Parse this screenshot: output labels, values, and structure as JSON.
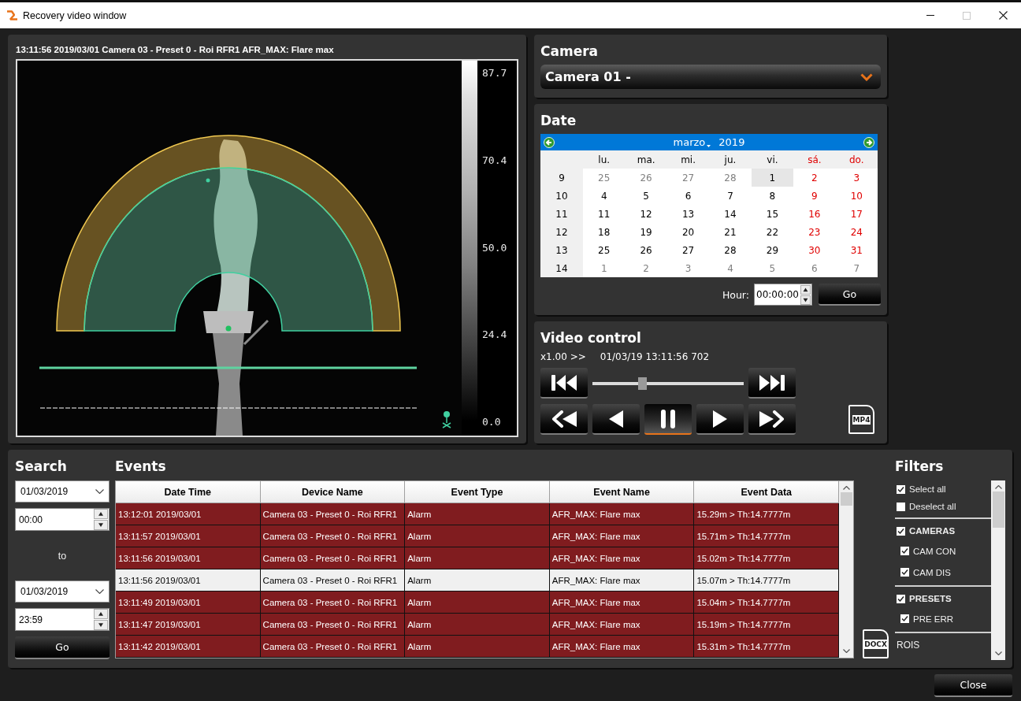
{
  "window": {
    "title": "Recovery video window",
    "controls": [
      {
        "kind": "minimize",
        "disabled": false
      },
      {
        "kind": "maximize",
        "disabled": true
      },
      {
        "kind": "close",
        "disabled": false
      }
    ]
  },
  "video": {
    "caption": "13:11:56 2019/03/01 Camera 03 - Preset 0 - Roi RFR1 AFR_MAX: Flare max",
    "scale_labels": [
      "87.7",
      "70.4",
      "50.0",
      "24.4",
      "0.0"
    ]
  },
  "camera": {
    "title": "Camera",
    "selected_camera": "Camera 01 -"
  },
  "date": {
    "title": "Date",
    "month": "marzo",
    "year": "2019",
    "weekdays": [
      {
        "label": "lu.",
        "kind": "weekday"
      },
      {
        "label": "ma.",
        "kind": "weekday"
      },
      {
        "label": "mi.",
        "kind": "weekday"
      },
      {
        "label": "ju.",
        "kind": "weekday"
      },
      {
        "label": "vi.",
        "kind": "weekday"
      },
      {
        "label": "sá.",
        "kind": "weekend"
      },
      {
        "label": "do.",
        "kind": "weekend"
      }
    ],
    "weeks": [
      {
        "number": "9",
        "days": [
          {
            "day": "25",
            "kind": "other",
            "selected": false
          },
          {
            "day": "26",
            "kind": "other",
            "selected": false
          },
          {
            "day": "27",
            "kind": "other",
            "selected": false
          },
          {
            "day": "28",
            "kind": "other",
            "selected": false
          },
          {
            "day": "1",
            "kind": "weekday",
            "selected": true
          },
          {
            "day": "2",
            "kind": "weekend",
            "selected": false
          },
          {
            "day": "3",
            "kind": "weekend",
            "selected": false
          }
        ]
      },
      {
        "number": "10",
        "days": [
          {
            "day": "4",
            "kind": "weekday",
            "selected": false
          },
          {
            "day": "5",
            "kind": "weekday",
            "selected": false
          },
          {
            "day": "6",
            "kind": "weekday",
            "selected": false
          },
          {
            "day": "7",
            "kind": "weekday",
            "selected": false
          },
          {
            "day": "8",
            "kind": "weekday",
            "selected": false
          },
          {
            "day": "9",
            "kind": "weekend",
            "selected": false
          },
          {
            "day": "10",
            "kind": "weekend",
            "selected": false
          }
        ]
      },
      {
        "number": "11",
        "days": [
          {
            "day": "11",
            "kind": "weekday",
            "selected": false
          },
          {
            "day": "12",
            "kind": "weekday",
            "selected": false
          },
          {
            "day": "13",
            "kind": "weekday",
            "selected": false
          },
          {
            "day": "14",
            "kind": "weekday",
            "selected": false
          },
          {
            "day": "15",
            "kind": "weekday",
            "selected": false
          },
          {
            "day": "16",
            "kind": "weekend",
            "selected": false
          },
          {
            "day": "17",
            "kind": "weekend",
            "selected": false
          }
        ]
      },
      {
        "number": "12",
        "days": [
          {
            "day": "18",
            "kind": "weekday",
            "selected": false
          },
          {
            "day": "19",
            "kind": "weekday",
            "selected": false
          },
          {
            "day": "20",
            "kind": "weekday",
            "selected": false
          },
          {
            "day": "21",
            "kind": "weekday",
            "selected": false
          },
          {
            "day": "22",
            "kind": "weekday",
            "selected": false
          },
          {
            "day": "23",
            "kind": "weekend",
            "selected": false
          },
          {
            "day": "24",
            "kind": "weekend",
            "selected": false
          }
        ]
      },
      {
        "number": "13",
        "days": [
          {
            "day": "25",
            "kind": "weekday",
            "selected": false
          },
          {
            "day": "26",
            "kind": "weekday",
            "selected": false
          },
          {
            "day": "27",
            "kind": "weekday",
            "selected": false
          },
          {
            "day": "28",
            "kind": "weekday",
            "selected": false
          },
          {
            "day": "29",
            "kind": "weekday",
            "selected": false
          },
          {
            "day": "30",
            "kind": "weekend",
            "selected": false
          },
          {
            "day": "31",
            "kind": "weekend",
            "selected": false
          }
        ]
      },
      {
        "number": "14",
        "days": [
          {
            "day": "1",
            "kind": "other",
            "selected": false
          },
          {
            "day": "2",
            "kind": "other",
            "selected": false
          },
          {
            "day": "3",
            "kind": "other",
            "selected": false
          },
          {
            "day": "4",
            "kind": "other",
            "selected": false
          },
          {
            "day": "5",
            "kind": "other",
            "selected": false
          },
          {
            "day": "6",
            "kind": "other",
            "selected": false
          },
          {
            "day": "7",
            "kind": "other",
            "selected": false
          }
        ]
      }
    ],
    "hour_label": "Hour:",
    "hour_value": "00:00:00",
    "go_button": "Go"
  },
  "video_control": {
    "title": "Video control",
    "speed": "x1.00 >>",
    "timestamp": "01/03/19 13:11:56 702",
    "position": {
      "level": 0.32
    },
    "buttons": [
      {
        "kind": "skip_start",
        "selected": false
      },
      {
        "kind": "skip_end",
        "selected": false
      },
      {
        "kind": "rewind",
        "selected": false
      },
      {
        "kind": "step_back",
        "selected": false
      },
      {
        "kind": "pause",
        "selected": true
      },
      {
        "kind": "play",
        "selected": false
      },
      {
        "kind": "fast_forward",
        "selected": false
      }
    ],
    "export_label": "MP4"
  },
  "search": {
    "title": "Search",
    "from_date": "01/03/2019",
    "from_time": "00:00",
    "separator": "to",
    "to_date": "01/03/2019",
    "to_time": "23:59",
    "go_button": "Go"
  },
  "events": {
    "title": "Events",
    "columns": [
      "Date Time",
      "Device Name",
      "Event Type",
      "Event Name",
      "Event Data"
    ],
    "rows": [
      {
        "cells": [
          "13:12:01 2019/03/01",
          "Camera 03 - Preset 0 - Roi RFR1",
          "Alarm",
          "AFR_MAX: Flare max",
          "15.29m > Th:14.7777m"
        ],
        "selected": false
      },
      {
        "cells": [
          "13:11:57 2019/03/01",
          "Camera 03 - Preset 0 - Roi RFR1",
          "Alarm",
          "AFR_MAX: Flare max",
          "15.71m > Th:14.7777m"
        ],
        "selected": false
      },
      {
        "cells": [
          "13:11:56 2019/03/01",
          "Camera 03 - Preset 0 - Roi RFR1",
          "Alarm",
          "AFR_MAX: Flare max",
          "15.02m > Th:14.7777m"
        ],
        "selected": false
      },
      {
        "cells": [
          "13:11:56 2019/03/01",
          "Camera 03 - Preset 0 - Roi RFR1",
          "Alarm",
          "AFR_MAX: Flare max",
          "15.07m > Th:14.7777m"
        ],
        "selected": true
      },
      {
        "cells": [
          "13:11:49 2019/03/01",
          "Camera 03 - Preset 0 - Roi RFR1",
          "Alarm",
          "AFR_MAX: Flare max",
          "15.04m > Th:14.7777m"
        ],
        "selected": false
      },
      {
        "cells": [
          "13:11:47 2019/03/01",
          "Camera 03 - Preset 0 - Roi RFR1",
          "Alarm",
          "AFR_MAX: Flare max",
          "15.19m > Th:14.7777m"
        ],
        "selected": false
      },
      {
        "cells": [
          "13:11:42 2019/03/01",
          "Camera 03 - Preset 0 - Roi RFR1",
          "Alarm",
          "AFR_MAX: Flare max",
          "15.31m > Th:14.7777m"
        ],
        "selected": false
      }
    ],
    "export_label": "DOCX"
  },
  "filters": {
    "title": "Filters",
    "options": [
      {
        "label": "Select all",
        "checked": true
      },
      {
        "label": "Deselect all",
        "checked": false
      }
    ],
    "groups": [
      {
        "label": "CAMERAS",
        "kind": "checkable",
        "checked": true,
        "children": [
          {
            "label": "CAM CON",
            "checked": true
          },
          {
            "label": "CAM DIS",
            "checked": true
          }
        ]
      },
      {
        "label": "PRESETS",
        "kind": "checkable",
        "checked": true,
        "children": [
          {
            "label": "PRE ERR",
            "checked": true
          }
        ]
      },
      {
        "label": "ROIS",
        "kind": "plain"
      }
    ]
  },
  "footer": {
    "close_button": "Close"
  }
}
